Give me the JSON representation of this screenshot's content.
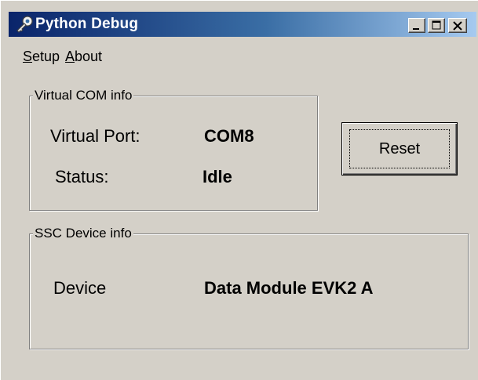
{
  "window": {
    "title": "Python Debug",
    "icon": "key-wrench-icon",
    "controls": {
      "minimize_icon": "minimize-icon",
      "maximize_icon": "maximize-icon",
      "close_icon": "close-icon"
    }
  },
  "menu": {
    "items": [
      {
        "mnemonic": "S",
        "rest": "etup"
      },
      {
        "mnemonic": "A",
        "rest": "bout"
      }
    ]
  },
  "virtual_com": {
    "title": "Virtual COM info",
    "port_label": "Virtual Port:",
    "port_value": "COM8",
    "status_label": "Status:",
    "status_value": "Idle"
  },
  "reset_button": {
    "label": "Reset"
  },
  "ssc_device": {
    "title": "SSC Device info",
    "device_label": "Device",
    "device_value": "Data Module EVK2 A"
  },
  "colors": {
    "title_gradient_start": "#0a246a",
    "title_gradient_end": "#a6caf0",
    "face": "#d4d0c8"
  }
}
